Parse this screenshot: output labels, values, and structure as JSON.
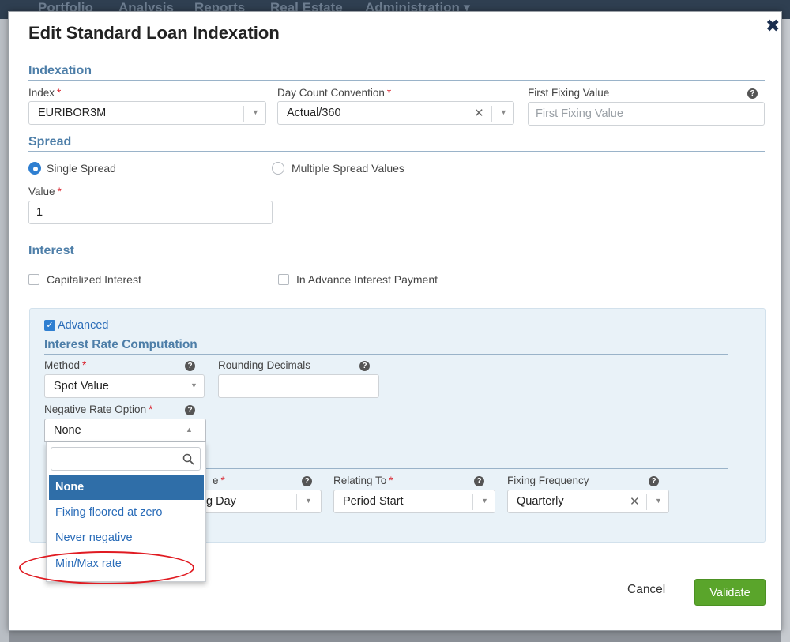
{
  "background_nav": {
    "items": [
      "Portfolio",
      "Analysis",
      "Reports",
      "Real Estate",
      "Administration ▾"
    ]
  },
  "modal": {
    "title": "Edit Standard Loan Indexation",
    "close_glyph": "✖"
  },
  "indexation": {
    "heading": "Indexation",
    "index_label": "Index",
    "index_value": "EURIBOR3M",
    "day_count_label": "Day Count Convention",
    "day_count_value": "Actual/360",
    "first_fixing_label": "First Fixing Value",
    "first_fixing_placeholder": "First Fixing Value",
    "first_fixing_value": ""
  },
  "spread": {
    "heading": "Spread",
    "option_single": "Single Spread",
    "option_multiple": "Multiple Spread Values",
    "selected": "single",
    "value_label": "Value",
    "value": "1"
  },
  "interest": {
    "heading": "Interest",
    "capitalized_label": "Capitalized Interest",
    "capitalized_checked": false,
    "advance_label": "In Advance Interest Payment",
    "advance_checked": false
  },
  "advanced": {
    "label": "Advanced",
    "checked": true,
    "computation_heading": "Interest Rate Computation",
    "method_label": "Method",
    "method_value": "Spot Value",
    "rounding_label": "Rounding Decimals",
    "rounding_value": "",
    "negative_rate_label": "Negative Rate Option",
    "negative_rate_value": "None",
    "hidden_label_fragment": "e",
    "hidden_value_fragment": "g Day",
    "relating_to_label": "Relating To",
    "relating_to_value": "Period Start",
    "fixing_frequency_label": "Fixing Frequency",
    "fixing_frequency_value": "Quarterly"
  },
  "dropdown": {
    "search_value": "",
    "options": [
      "None",
      "Fixing floored at zero",
      "Never negative",
      "Min/Max rate"
    ],
    "selected_index": 0,
    "highlighted_option": "Min/Max rate"
  },
  "footer": {
    "cancel_label": "Cancel",
    "validate_label": "Validate"
  },
  "colors": {
    "section_heading": "#4d7ea8",
    "required_star": "#d9232e",
    "validate_button": "#5aa52b",
    "selected_option": "#2f6ea8",
    "annotation_ellipse": "#e01b22"
  }
}
